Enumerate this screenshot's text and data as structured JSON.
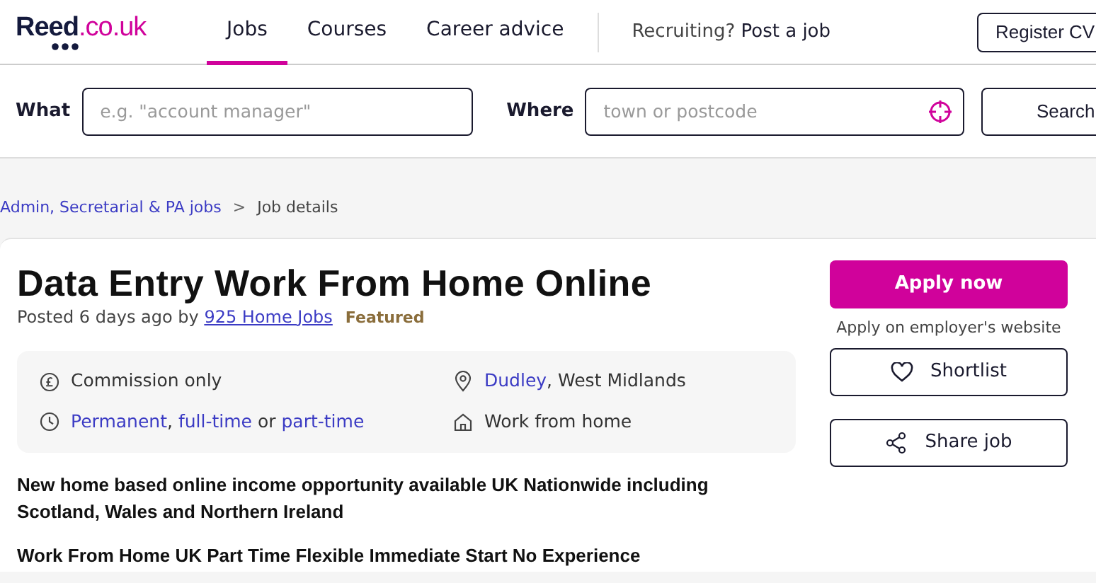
{
  "header": {
    "logo": {
      "name": "Reed",
      "suffix": ".co.uk"
    },
    "nav": [
      {
        "label": "Jobs",
        "selected": true
      },
      {
        "label": "Courses",
        "selected": false
      },
      {
        "label": "Career advice",
        "selected": false
      }
    ],
    "recruiting": {
      "prompt": "Recruiting?",
      "link": "Post a job"
    },
    "register_button": "Register CV"
  },
  "search": {
    "what_label": "What",
    "what_placeholder": "e.g. \"account manager\"",
    "where_label": "Where",
    "where_placeholder": "town or postcode",
    "button": "Search"
  },
  "breadcrumb": [
    {
      "label": "Admin, Secretarial & PA jobs",
      "kind": "link"
    },
    {
      "label": ">",
      "kind": "separator"
    },
    {
      "label": "Job details",
      "kind": "current"
    }
  ],
  "job": {
    "title": "Data Entry Work From Home Online",
    "posted": "Posted 6 days ago by",
    "company": "925 Home Jobs",
    "badge": "Featured",
    "facts": [
      {
        "kind": "salary",
        "parts": [
          {
            "text": "Commission only",
            "link": false
          }
        ]
      },
      {
        "kind": "location",
        "parts": [
          {
            "text": "Dudley",
            "link": true
          },
          {
            "text": ", West Midlands",
            "link": false
          }
        ]
      },
      {
        "kind": "type",
        "parts": [
          {
            "text": "Permanent",
            "link": true
          },
          {
            "text": ",",
            "link": false
          },
          {
            "text": "full-time",
            "link": true
          },
          {
            "text": "or",
            "link": false
          },
          {
            "text": "part-time",
            "link": true
          }
        ]
      },
      {
        "kind": "remote",
        "parts": [
          {
            "text": "Work from home",
            "link": false
          }
        ]
      }
    ],
    "description": [
      "New home based online income opportunity available UK Nationwide including Scotland, Wales and Northern Ireland",
      "Work From Home UK Part Time Flexible Immediate Start No Experience"
    ]
  },
  "actions": {
    "apply": "Apply now",
    "apply_note": "Apply on employer's website",
    "shortlist": "Shortlist",
    "share": "Share job"
  }
}
